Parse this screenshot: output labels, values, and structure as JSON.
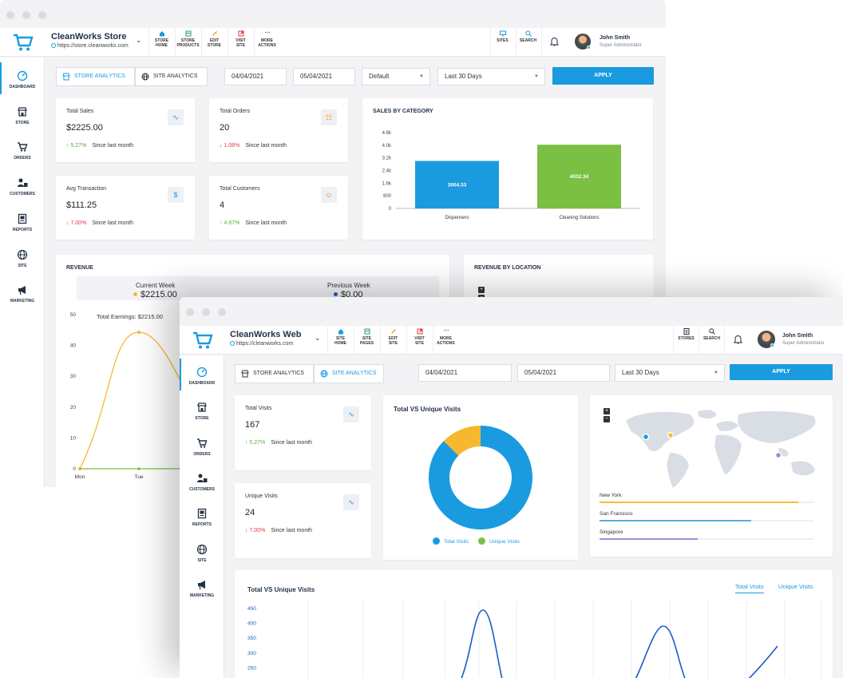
{
  "back_window": {
    "app": {
      "name": "CleanWorks Store",
      "url": "https://store.cleanworks.com"
    },
    "toolbar": [
      {
        "icon": "home-icon",
        "l1": "STORE",
        "l2": "HOME"
      },
      {
        "icon": "products-icon",
        "l1": "STORE",
        "l2": "PRODUCTS"
      },
      {
        "icon": "edit-icon",
        "l1": "EDIT",
        "l2": "STORE"
      },
      {
        "icon": "visit-icon",
        "l1": "VISIT",
        "l2": "SITE"
      },
      {
        "icon": "more-icon",
        "l1": "MORE",
        "l2": "ACTIONS"
      }
    ],
    "right_tools": [
      {
        "icon": "monitor-icon",
        "label": "SITES"
      },
      {
        "icon": "search-icon",
        "label": "SEARCH"
      }
    ],
    "user": {
      "name": "John Smith",
      "role": "Super Administrator"
    },
    "sidebar": [
      "DASHBOARD",
      "STORE",
      "ORDERS",
      "CUSTOMERS",
      "REPORTS",
      "SITE",
      "MARKETING"
    ],
    "tabs": [
      "STORE ANALYTICS",
      "SITE ANALYTICS"
    ],
    "filters": {
      "date_from": "04/04/2021",
      "date_to": "05/04/2021",
      "compare": "Default",
      "range": "Last 30 Days",
      "apply": "APPLY"
    },
    "kpis": [
      {
        "title": "Total Sales",
        "value": "$2225.00",
        "change": "5.27%",
        "dir": "up",
        "since": "Since last month",
        "icon": "pulse-icon"
      },
      {
        "title": "Total Orders",
        "value": "20",
        "change": "1.08%",
        "dir": "down",
        "since": "Since last month",
        "icon": "cart-icon"
      },
      {
        "title": "Avg Transaction",
        "value": "$111.25",
        "change": "7.00%",
        "dir": "down",
        "since": "Since last month",
        "icon": "dollar-icon"
      },
      {
        "title": "Total Customers",
        "value": "4",
        "change": "4.87%",
        "dir": "up",
        "since": "Since last month",
        "icon": "people-icon"
      }
    ],
    "sales_by_category": {
      "title": "SALES BY CATEGORY",
      "chart_data": {
        "type": "bar",
        "categories": [
          "Dispensers",
          "Cleaning Solutions"
        ],
        "values": [
          3004.33,
          4032.34
        ],
        "value_labels": [
          "3004.33",
          "4032.34"
        ],
        "yticks": [
          "4.8k",
          "4.0k",
          "3.2k",
          "2.4k",
          "1.6k",
          "800",
          "0"
        ],
        "ylim": [
          0,
          4800
        ],
        "colors": [
          "#1a9be0",
          "#7bc043"
        ]
      }
    },
    "revenue": {
      "title": "REVENUE",
      "current_week": {
        "label": "Current Week",
        "value": "$2215.00"
      },
      "previous_week": {
        "label": "Previous Week",
        "value": "$0.00"
      },
      "annotation": "Total Earnings: $2215.00",
      "chart_data": {
        "type": "line",
        "categories": [
          "Mon",
          "Tue"
        ],
        "yticks": [
          "50",
          "40",
          "30",
          "20",
          "10",
          "0"
        ],
        "ylim": [
          0,
          50
        ],
        "series": [
          {
            "name": "Current Week",
            "peak": 44.3,
            "color": "#f5b82e"
          },
          {
            "name": "Previous Week",
            "values": [
              0,
              0
            ],
            "color": "#7bc043"
          }
        ]
      }
    },
    "revenue_by_location_title": "REVENUE BY LOCATION"
  },
  "front_window": {
    "app": {
      "name": "CleanWorks Web",
      "url": "https://cleanworks.com"
    },
    "toolbar": [
      {
        "icon": "home-icon",
        "l1": "SITE",
        "l2": "HOME"
      },
      {
        "icon": "pages-icon",
        "l1": "SITE",
        "l2": "PAGES"
      },
      {
        "icon": "edit-icon",
        "l1": "EDIT",
        "l2": "SITE"
      },
      {
        "icon": "visit-icon",
        "l1": "VISIT",
        "l2": "SITE"
      },
      {
        "icon": "more-icon",
        "l1": "MORE",
        "l2": "ACTIONS"
      }
    ],
    "right_tools": [
      {
        "icon": "stores-icon",
        "label": "STORES"
      },
      {
        "icon": "search-icon",
        "label": "SEARCH"
      }
    ],
    "user": {
      "name": "John Smith",
      "role": "Super Administrator"
    },
    "sidebar": [
      "DASHBOARD",
      "STORE",
      "ORDERS",
      "CUSTOMERS",
      "REPORTS",
      "SITE",
      "MARKETING"
    ],
    "tabs": [
      "STORE ANALYTICS",
      "SITE ANALYTICS"
    ],
    "filters": {
      "date_from": "04/04/2021",
      "date_to": "05/04/2021",
      "range": "Last 30 Days",
      "apply": "APPLY"
    },
    "kpis": [
      {
        "title": "Total Visits",
        "value": "167",
        "change": "5.27%",
        "dir": "up",
        "since": "Since last month",
        "icon": "pulse-icon"
      },
      {
        "title": "Unique Visits",
        "value": "24",
        "change": "7.00%",
        "dir": "down",
        "since": "Since last month",
        "icon": "pulse-icon"
      }
    ],
    "donut": {
      "title": "Total VS Unique Visits",
      "chart_data": {
        "type": "pie",
        "labels": [
          "Total Visits",
          "Unique Visits"
        ],
        "values": [
          167,
          24
        ],
        "colors": [
          "#1a9be0",
          "#f5b82e"
        ],
        "legend_colors": [
          "#1a9be0",
          "#7bc043"
        ],
        "legend": "bottom"
      }
    },
    "locations": [
      {
        "name": "New York",
        "fraction": 0.93,
        "color": "#f5c131"
      },
      {
        "name": "San Francisco",
        "fraction": 0.71,
        "color": "#5aaee8"
      },
      {
        "name": "Singapore",
        "fraction": 0.46,
        "color": "#a78be0"
      }
    ],
    "visits_chart": {
      "title": "Total VS Unique Visits",
      "tabs": [
        "Total Visits",
        "Unique Visits"
      ],
      "chart_data": {
        "type": "line",
        "yticks": [
          "450",
          "400",
          "350",
          "300",
          "250"
        ],
        "ylim": [
          230,
          460
        ],
        "series": [
          {
            "name": "Total Visits",
            "color": "#1a5bc4"
          }
        ]
      }
    }
  }
}
